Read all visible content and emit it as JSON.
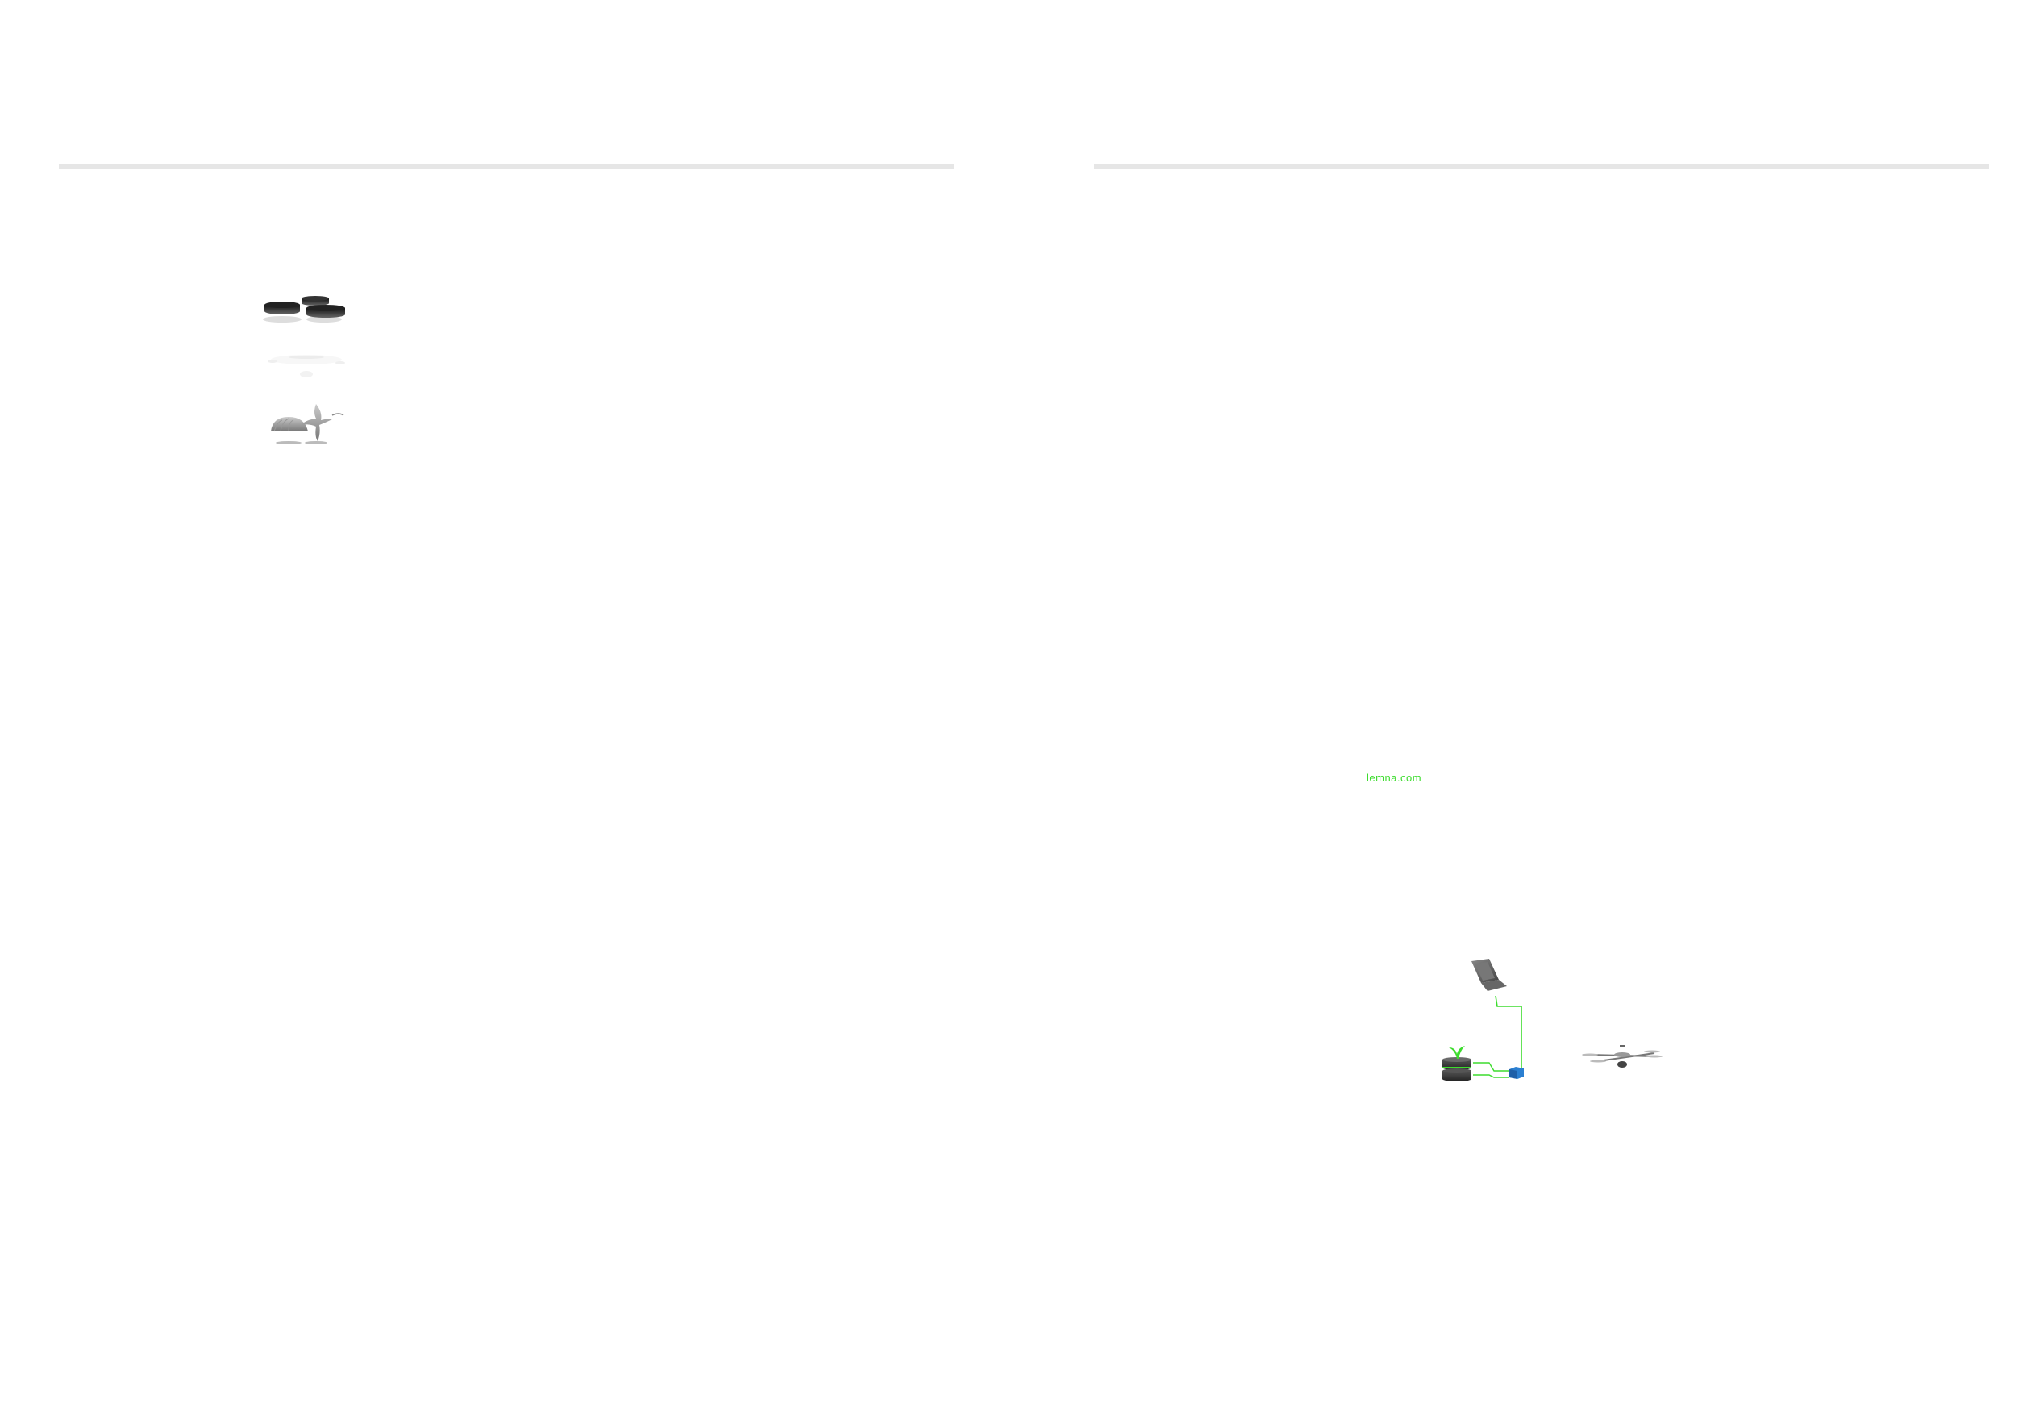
{
  "right_page": {
    "url_text": "lemna.com",
    "accent_color": "#3ddc2e"
  },
  "icons": {
    "left_stack": [
      "stacked-discs-icon",
      "flat-disc-icon",
      "organic-shapes-icon"
    ],
    "diagram": [
      "laptop-icon",
      "plant-server-icon",
      "connector-box-icon",
      "drone-icon"
    ]
  }
}
